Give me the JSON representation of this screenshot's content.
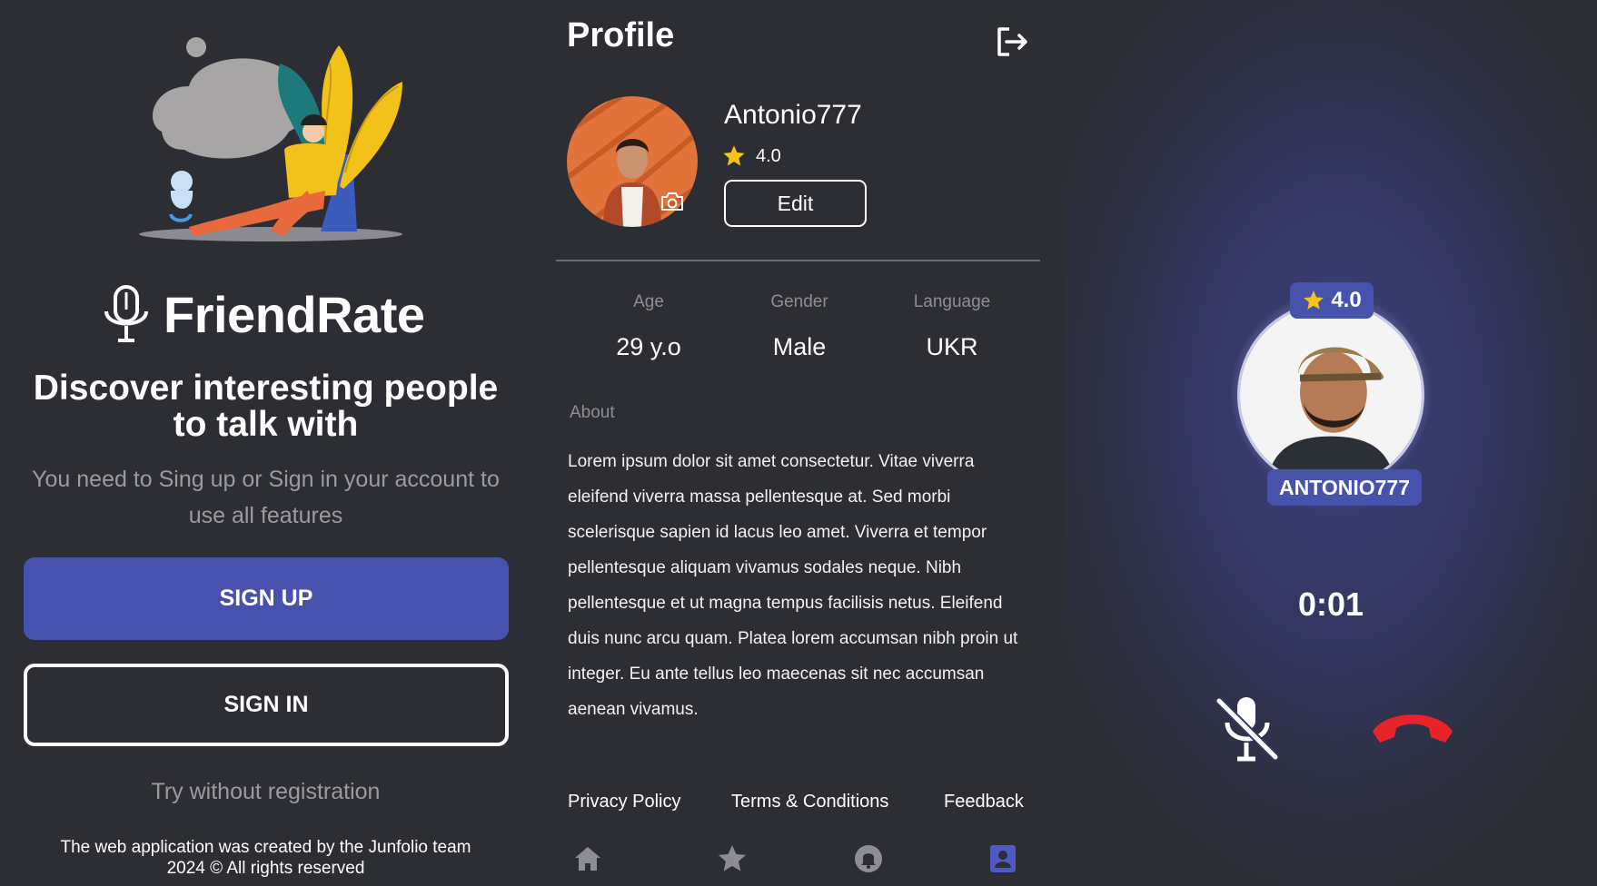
{
  "welcome": {
    "brand_name": "FriendRate",
    "headline": "Discover interesting people to talk with",
    "subtitle": "You need to Sing up or Sign in your account to use all features",
    "sign_up_label": "SIGN UP",
    "sign_in_label": "SIGN IN",
    "try_label": "Try without registration",
    "credits_line1": "The web application was created by the Junfolio team",
    "credits_line2": "2024 © All rights reserved"
  },
  "profile": {
    "title": "Profile",
    "username": "Antonio777",
    "rating": "4.0",
    "edit_label": "Edit",
    "stats": [
      {
        "label": "Age",
        "value": "29 y.o"
      },
      {
        "label": "Gender",
        "value": "Male"
      },
      {
        "label": "Language",
        "value": "UKR"
      }
    ],
    "about_label": "About",
    "about_text": "Lorem ipsum dolor sit amet consectetur. Vitae viverra eleifend viverra massa pellentesque at. Sed morbi scelerisque sapien id lacus leo amet. Viverra et tempor pellentesque aliquam vivamus sodales neque. Nibh pellentesque et ut magna tempus facilisis netus. Eleifend duis nunc arcu quam. Platea lorem accumsan nibh proin ut integer. Eu ante tellus leo maecenas sit nec accumsan aenean vivamus.",
    "footer_links": [
      "Privacy Policy",
      "Terms & Conditions",
      "Feedback"
    ],
    "nav": [
      {
        "icon": "home-icon",
        "active": false
      },
      {
        "icon": "star-icon",
        "active": false
      },
      {
        "icon": "bell-icon",
        "active": false
      },
      {
        "icon": "profile-icon",
        "active": true
      }
    ]
  },
  "call": {
    "rating": "4.0",
    "caller_name": "ANTONIO777",
    "timer": "0:01"
  },
  "colors": {
    "accent": "#4652ac",
    "background": "#2d2e33",
    "star": "#f7c31b",
    "hangup": "#e8232a",
    "muted_text": "#9a9ba1"
  }
}
